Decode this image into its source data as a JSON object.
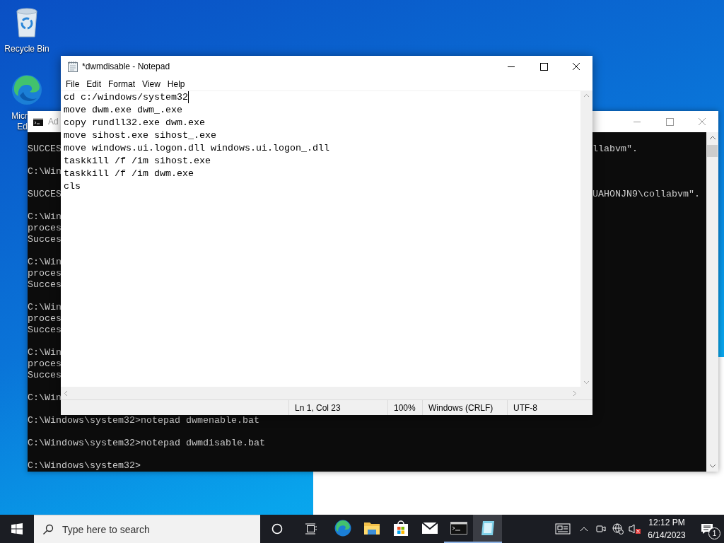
{
  "desktop_icons": [
    {
      "kind": "recycle",
      "label_lines": [
        "Recycle Bin"
      ]
    },
    {
      "kind": "edge",
      "label_lines": [
        "Micr",
        "Ed"
      ]
    }
  ],
  "cmd_window": {
    "title": "Ad",
    "blocks": [
      [
        {
          "left": "SUCCES",
          "right": "llabvm\"."
        }
      ],
      [
        {
          "left": "C:\\Win"
        }
      ],
      [
        {
          "left": "SUCCES",
          "right": "UAHONJN9\\collabvm\"."
        }
      ],
      [
        {
          "left": "C:\\Win"
        },
        {
          "left": "proces"
        },
        {
          "left": "Succes"
        }
      ],
      [
        {
          "left": "C:\\Win"
        },
        {
          "left": "proces"
        },
        {
          "left": "Succes"
        }
      ],
      [
        {
          "left": "C:\\Win"
        },
        {
          "left": "proces"
        },
        {
          "left": "Succes"
        }
      ],
      [
        {
          "left": "C:\\Win"
        },
        {
          "left": "proces"
        },
        {
          "left": "Succes"
        }
      ],
      [
        {
          "left": "C:\\Win"
        }
      ],
      [
        {
          "left": "C:\\Windows\\system32>notepad dwmenable.bat"
        }
      ],
      [
        {
          "left": "C:\\Windows\\system32>notepad dwmdisable.bat"
        }
      ],
      [
        {
          "left": "C:\\Windows\\system32>"
        }
      ]
    ]
  },
  "notepad": {
    "title": "*dwmdisable - Notepad",
    "menu": [
      "File",
      "Edit",
      "Format",
      "View",
      "Help"
    ],
    "lines": [
      {
        "text": "cd c:/windows/system32",
        "caret": true
      },
      {
        "text": "move dwm.exe dwm_.exe",
        "caret": false
      },
      {
        "text": "copy rundll32.exe dwm.exe",
        "caret": false
      },
      {
        "text": "move sihost.exe sihost_.exe",
        "caret": false
      },
      {
        "text": "move windows.ui.logon.dll windows.ui.logon_.dll",
        "caret": false
      },
      {
        "text": "taskkill /f /im sihost.exe",
        "caret": false
      },
      {
        "text": "taskkill /f /im dwm.exe",
        "caret": false
      },
      {
        "text": "cls",
        "caret": false
      }
    ],
    "status": [
      "Ln 1, Col 23",
      "100%",
      "Windows (CRLF)",
      "UTF-8"
    ]
  },
  "taskbar": {
    "search_placeholder": "Type here to search",
    "apps": [
      {
        "kind": "edge",
        "running": false,
        "selected": false
      },
      {
        "kind": "explorer",
        "running": false,
        "selected": false
      },
      {
        "kind": "store",
        "running": false,
        "selected": false
      },
      {
        "kind": "mail",
        "running": false,
        "selected": false
      },
      {
        "kind": "terminal",
        "running": true,
        "selected": false
      },
      {
        "kind": "notepad",
        "running": true,
        "selected": true
      }
    ],
    "time": "12:12 PM",
    "date": "6/14/2023",
    "notification_count": "1"
  }
}
